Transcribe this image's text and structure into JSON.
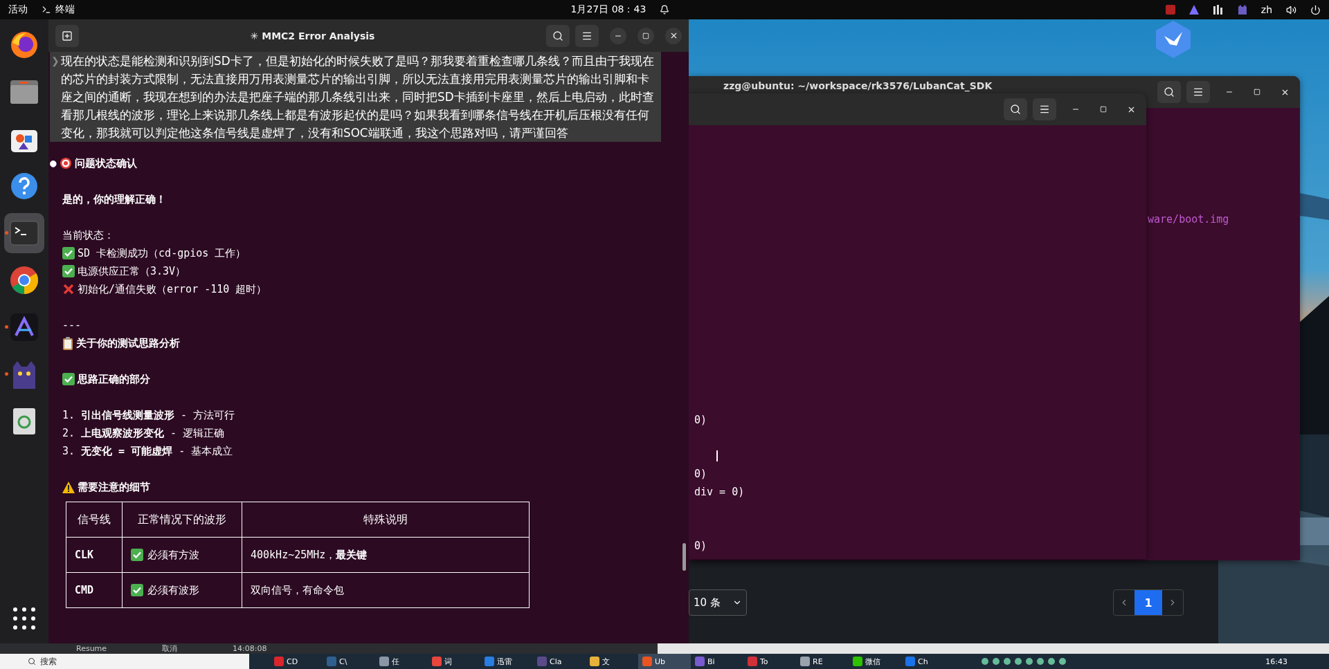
{
  "top_bar": {
    "activities": "活动",
    "app_name": "终端",
    "clock": "1月27日  08：43",
    "input_method": "zh"
  },
  "dock": {
    "items": [
      {
        "kind": "firefox",
        "selected": false,
        "running": false
      },
      {
        "kind": "files",
        "selected": false,
        "running": false
      },
      {
        "kind": "software",
        "selected": false,
        "running": false
      },
      {
        "kind": "help",
        "selected": false,
        "running": false
      },
      {
        "kind": "terminal",
        "selected": true,
        "running": true
      },
      {
        "kind": "chrome",
        "selected": false,
        "running": false
      },
      {
        "kind": "assistant",
        "selected": false,
        "running": true
      },
      {
        "kind": "cat",
        "selected": false,
        "running": true
      },
      {
        "kind": "trash",
        "selected": false,
        "running": false
      }
    ]
  },
  "terminal": {
    "title": "✳ MMC2 Error Analysis",
    "prompt": {
      "marker": "❯",
      "text": "现在的状态是能检测和识别到SD卡了，但是初始化的时候失败了是吗？那我要着重检查哪几条线？而且由于我现在的芯片的封装方式限制，无法直接用万用表测量芯片的输出引脚，所以无法直接用完用表测量芯片的输出引脚和卡座之间的通断，我现在想到的办法是把座子端的那几条线引出来，同时把SD卡插到卡座里，然后上电启动，此时查看那几根线的波形，理论上来说那几条线上都是有波形起伏的是吗？如果我看到哪条信号线在开机后压根没有任何变化，那我就可以判定他这条信号线是虚焊了，没有和SOC端联通，我这个思路对吗，请严谨回答"
    },
    "blocks": [
      [
        {
          "kind": "goal",
          "bullet": "●",
          "text": "问题状态确认"
        }
      ],
      [
        {
          "kind": "strong",
          "text": "是的，你的理解正确！"
        }
      ],
      [
        {
          "kind": "text",
          "text": "当前状态："
        },
        {
          "kind": "ok",
          "text": "SD 卡检测成功（cd-gpios 工作）"
        },
        {
          "kind": "ok",
          "text": "电源供应正常（3.3V）"
        },
        {
          "kind": "fail",
          "text": "初始化/通信失败（error -110 超时）"
        }
      ],
      [
        {
          "kind": "text",
          "text": "---"
        },
        {
          "kind": "section",
          "text": "关于你的测试思路分析"
        }
      ],
      [
        {
          "kind": "approved",
          "text": "思路正确的部分"
        }
      ],
      [
        {
          "kind": "text",
          "text": "1. **引出信号线测量波形** - 方法可行"
        },
        {
          "kind": "text",
          "text": "2. **上电观察波形变化** - 逻辑正确"
        },
        {
          "kind": "text",
          "text": "3. **无变化 = 可能虚焊** - 基本成立"
        }
      ],
      [
        {
          "kind": "caution",
          "text": "需要注意的细节"
        }
      ]
    ],
    "table": {
      "columns": [
        "信号线",
        "正常情况下的波形",
        "特殊说明"
      ],
      "rows": [
        {
          "kind": "ok",
          "signal": "CLK",
          "wave": "必须有方波",
          "note": "400kHz~25MHz，**最关键**"
        },
        {
          "kind": "ok",
          "signal": "CMD",
          "wave": "必须有波形",
          "note": "双向信号，有命令包"
        }
      ]
    }
  },
  "desktop": {
    "back_window": {
      "title": "zzg@ubuntu: ~/workspace/rk3576/LubanCat_SDK",
      "lines": [
        "ware/boot.img"
      ]
    },
    "front_window": {
      "groups": [
        [
          "0)"
        ],
        [
          "0)",
          "div = 0)"
        ],
        [
          "0)"
        ]
      ]
    },
    "list_panel": {
      "page_size": "10 条",
      "pages": [
        {
          "label": "1",
          "selected": true
        }
      ]
    }
  },
  "bottom_strip": {
    "cells": [
      "Resume",
      "取消",
      "14:08:08"
    ]
  },
  "taskbar": {
    "search_placeholder": "搜索",
    "apps": [
      {
        "label": "CD",
        "color": "#d8262c",
        "selected": false
      },
      {
        "label": "C\\",
        "color": "#2f5f8f",
        "selected": false
      },
      {
        "label": "任",
        "color": "#8a96a6",
        "selected": false
      },
      {
        "label": "词",
        "color": "#e8453c",
        "selected": false
      },
      {
        "label": "迅雷",
        "color": "#2a7de1",
        "selected": false
      },
      {
        "label": "Cla",
        "color": "#5a4a8a",
        "selected": false
      },
      {
        "label": "文",
        "color": "#e8b13a",
        "selected": false
      },
      {
        "label": "Ub",
        "color": "#e95420",
        "selected": true
      },
      {
        "label": "Bi",
        "color": "#7a5ad0",
        "selected": false
      },
      {
        "label": "To",
        "color": "#d0303a",
        "selected": false
      },
      {
        "label": "RE",
        "color": "#9aa3ad",
        "selected": false
      },
      {
        "label": "微信",
        "color": "#2dc100",
        "selected": false
      },
      {
        "label": "Ch",
        "color": "#1a73e8",
        "selected": false
      }
    ],
    "clock": "16:43"
  }
}
